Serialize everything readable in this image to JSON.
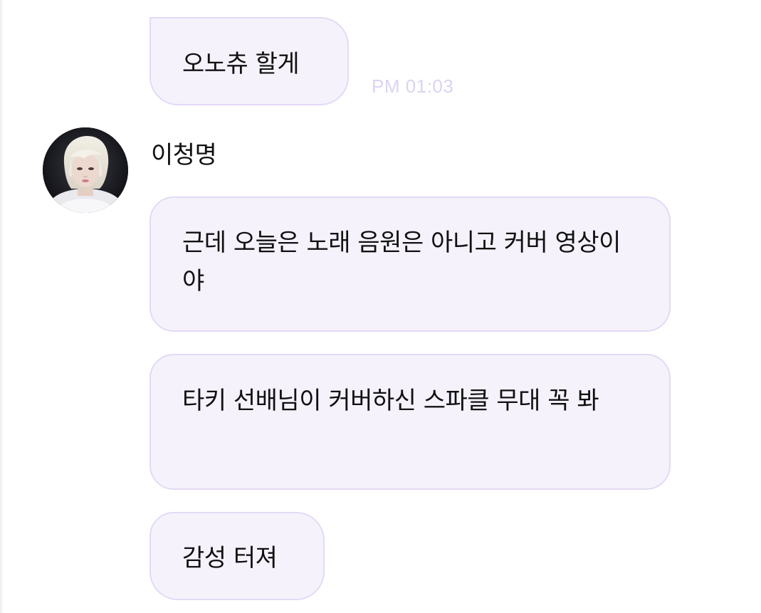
{
  "chat": {
    "timestamp": "PM 01:03",
    "sender": {
      "name": "이청명",
      "avatar": "profile-photo"
    },
    "messages": [
      {
        "text": "오노츄 할게"
      },
      {
        "text": "근데 오늘은 노래 음원은 아니고 커버 영상이야"
      },
      {
        "text": "타키 선배님이 커버하신 스파클 무대 꼭 봐"
      },
      {
        "text": "감성 터져"
      }
    ]
  },
  "colors": {
    "bubble_bg": "#f5f2fc",
    "bubble_border": "#e3daf5",
    "timestamp": "#dcd3f2",
    "text": "#111111"
  }
}
